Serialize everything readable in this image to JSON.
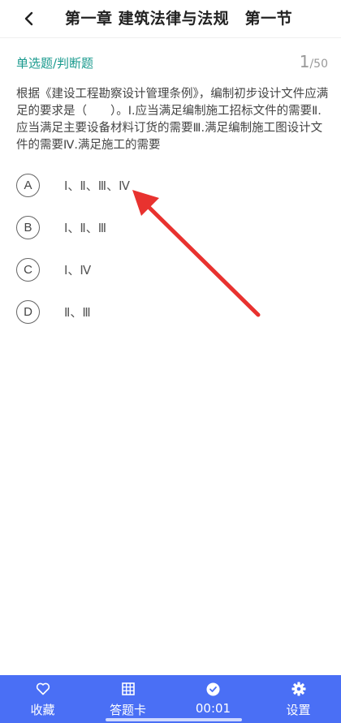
{
  "header": {
    "title": "第一章 建筑法律与法规　第一节"
  },
  "question": {
    "type": "单选题/判断题",
    "current": "1",
    "total": "/50",
    "stem": "根据《建设工程勘察设计管理条例》，编制初步设计文件应满足的要求是（　　）。Ⅰ.应当满足编制施工招标文件的需要Ⅱ.应当满足主要设备材料订货的需要Ⅲ.满足编制施工图设计文件的需要Ⅳ.满足施工的需要",
    "options": [
      {
        "letter": "A",
        "text": "Ⅰ、Ⅱ、Ⅲ、Ⅳ"
      },
      {
        "letter": "B",
        "text": "Ⅰ、Ⅱ、Ⅲ"
      },
      {
        "letter": "C",
        "text": "Ⅰ、Ⅳ"
      },
      {
        "letter": "D",
        "text": "Ⅱ、Ⅲ"
      }
    ]
  },
  "bottom_bar": {
    "favorite": {
      "label": "收藏",
      "icon": "heart-icon"
    },
    "answer_card": {
      "label": "答题卡",
      "icon": "grid-icon"
    },
    "timer": {
      "label": "00:01",
      "icon": "clock-icon"
    },
    "settings": {
      "label": "设置",
      "icon": "gear-icon"
    }
  },
  "colors": {
    "accent": "#4a6ff5",
    "question_type": "#1a9a8e",
    "annotation_arrow": "#e8322f"
  }
}
